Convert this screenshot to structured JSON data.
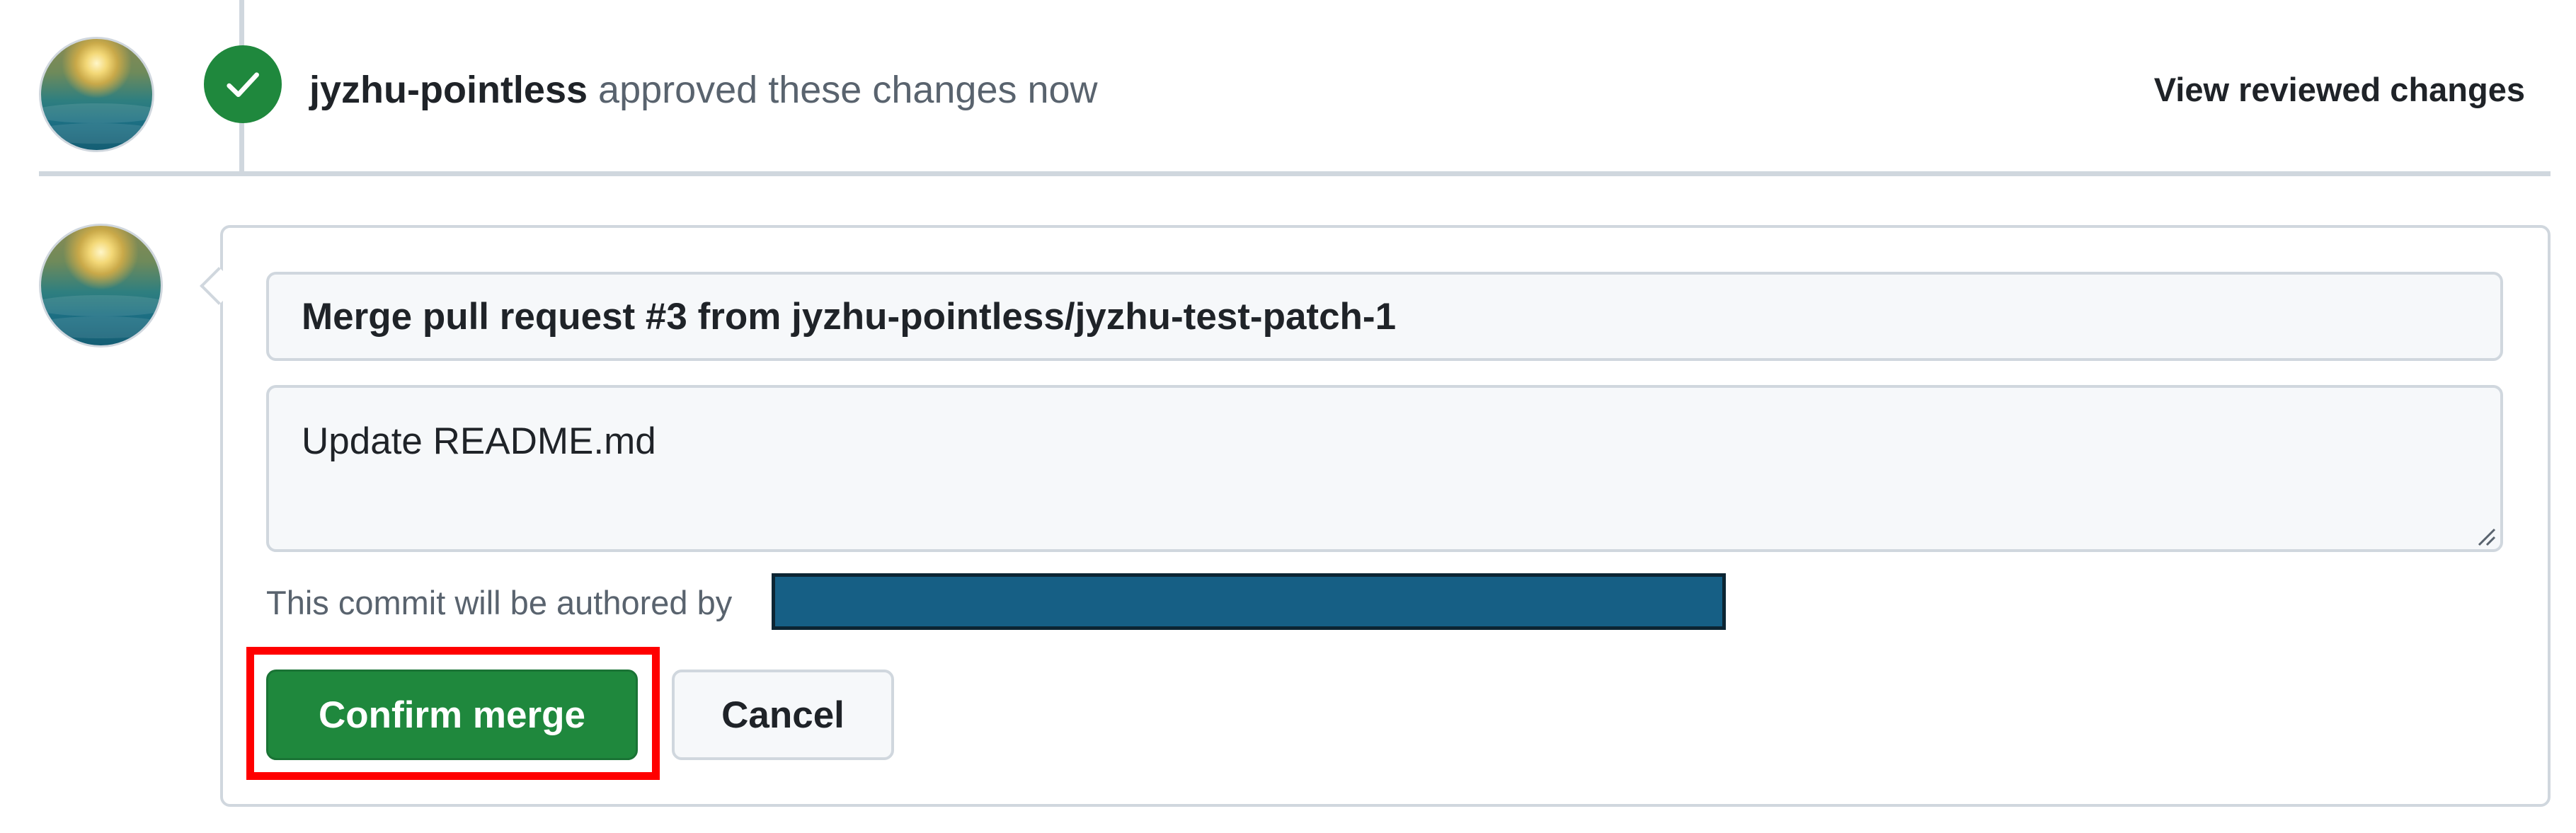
{
  "review_event": {
    "author": "jyzhu-pointless",
    "action_text": " approved these changes now",
    "view_link": "View reviewed changes",
    "status_color": "#1f883d"
  },
  "merge_form": {
    "title_value": "Merge pull request #3 from jyzhu-pointless/jyzhu-test-patch-1",
    "message_value": "Update README.md",
    "authored_by_label": "This commit will be authored by",
    "confirm_label": "Confirm merge",
    "cancel_label": "Cancel",
    "confirm_color": "#1f883d"
  },
  "icons": {
    "approval": "check-icon",
    "resize": "resize-grip-icon"
  },
  "annotation": {
    "highlight_color": "#ff0000"
  }
}
